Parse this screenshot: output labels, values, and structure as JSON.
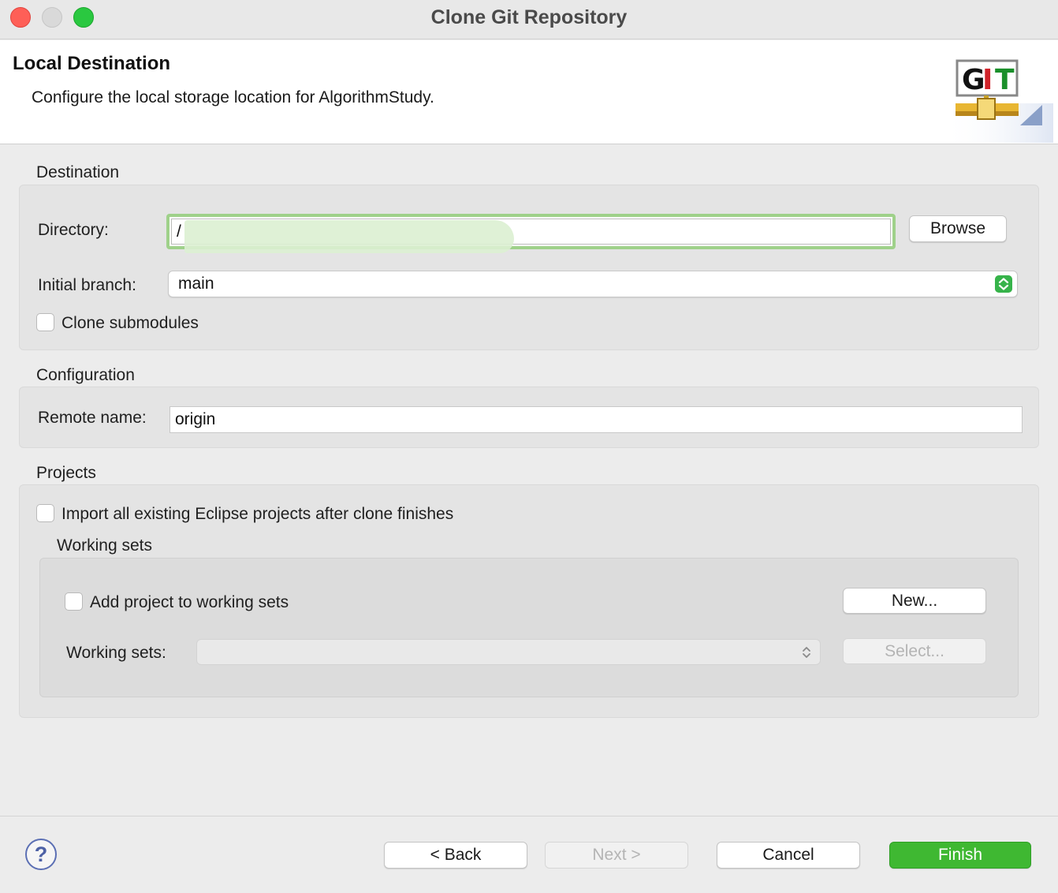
{
  "window": {
    "title": "Clone Git Repository"
  },
  "header": {
    "title": "Local Destination",
    "description": "Configure the local storage location for AlgorithmStudy.",
    "logo_icon": "git-logo-icon"
  },
  "destination": {
    "section_label": "Destination",
    "directory_label": "Directory:",
    "directory_value": "/",
    "browse_label": "Browse",
    "initial_branch_label": "Initial branch:",
    "initial_branch_value": "main",
    "clone_submodules_label": "Clone submodules"
  },
  "configuration": {
    "section_label": "Configuration",
    "remote_name_label": "Remote name:",
    "remote_name_value": "origin"
  },
  "projects": {
    "section_label": "Projects",
    "import_label": "Import all existing Eclipse projects after clone finishes",
    "working_sets_group_label": "Working sets",
    "add_to_working_sets_label": "Add project to working sets",
    "new_label": "New...",
    "working_sets_label": "Working sets:",
    "working_sets_value": "",
    "select_label": "Select..."
  },
  "footer": {
    "help_icon": "help-icon",
    "help_glyph": "?",
    "back_label": "< Back",
    "next_label": "Next >",
    "cancel_label": "Cancel",
    "finish_label": "Finish"
  },
  "colors": {
    "accent_green": "#3fb832",
    "focus_ring": "#9fd18a",
    "close": "#fe5f57",
    "maximize": "#2ac840"
  }
}
